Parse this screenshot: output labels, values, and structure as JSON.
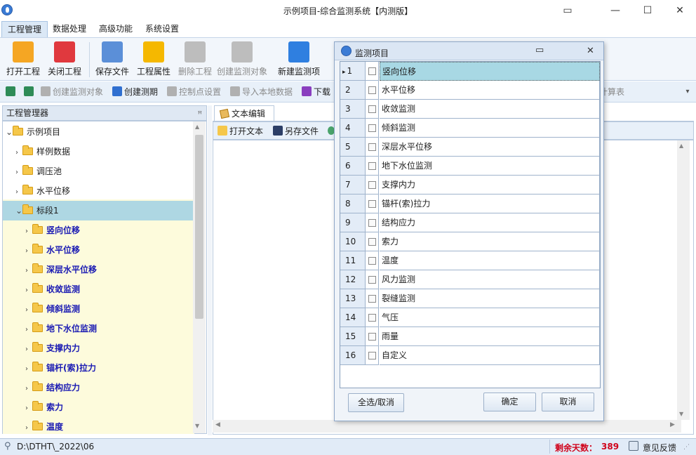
{
  "window": {
    "title": "示例项目-综合监测系统【内测版】",
    "controls": [
      "▭",
      "—",
      "☐",
      "✕"
    ]
  },
  "menu": [
    "工程管理",
    "数据处理",
    "高级功能",
    "系统设置"
  ],
  "ribbon": [
    {
      "label": "打开工程",
      "icon": "open-folder-icon",
      "color": "#f5a623",
      "disabled": false
    },
    {
      "label": "关闭工程",
      "icon": "close-x-icon",
      "color": "#e0393e",
      "disabled": false
    },
    {
      "label": "保存文件",
      "icon": "save-disk-icon",
      "color": "#5b8fd8",
      "disabled": false
    },
    {
      "label": "工程属性",
      "icon": "properties-icon",
      "color": "#f5b800",
      "disabled": false
    },
    {
      "label": "删除工程",
      "icon": "delete-icon",
      "color": "#bdbdbd",
      "disabled": true
    },
    {
      "label": "创建监测对象",
      "icon": "create-object-icon",
      "color": "#bdbdbd",
      "disabled": true
    },
    {
      "label": "新建监测项",
      "icon": "new-item-icon",
      "color": "#2f7fe0",
      "disabled": false
    }
  ],
  "toolbar2": [
    {
      "label": "",
      "icon": "expand-icon",
      "color": "#2e8b57",
      "disabled": false
    },
    {
      "label": "",
      "icon": "tools-icon",
      "color": "#2e8b57",
      "disabled": false
    },
    {
      "label": "创建监测对象",
      "icon": "create-object-icon",
      "color": "#b0b0b0",
      "disabled": true
    },
    {
      "label": "创建测期",
      "icon": "period-icon",
      "color": "#2f6fd0",
      "disabled": false
    },
    {
      "label": "控制点设置",
      "icon": "control-point-icon",
      "color": "#b0b0b0",
      "disabled": true
    },
    {
      "label": "导入本地数据",
      "icon": "import-icon",
      "color": "#b0b0b0",
      "disabled": true
    },
    {
      "label": "下载",
      "icon": "download-icon",
      "color": "#8a3fbf",
      "disabled": false
    }
  ],
  "toolbar2_right_fragment": "计算表",
  "left_panel": {
    "title": "工程管理器",
    "pin": "ꟸ",
    "tree": [
      {
        "label": "示例项目",
        "level": 0,
        "expanded": true,
        "style": "normal"
      },
      {
        "label": "样例数据",
        "level": 1,
        "expanded": false,
        "style": "normal"
      },
      {
        "label": "调压池",
        "level": 1,
        "expanded": false,
        "style": "normal"
      },
      {
        "label": "水平位移",
        "level": 1,
        "expanded": false,
        "style": "normal"
      },
      {
        "label": "标段1",
        "level": 1,
        "expanded": true,
        "style": "selected"
      },
      {
        "label": "竖向位移",
        "level": 2,
        "expanded": false,
        "style": "blue"
      },
      {
        "label": "水平位移",
        "level": 2,
        "expanded": false,
        "style": "blue"
      },
      {
        "label": "深层水平位移",
        "level": 2,
        "expanded": false,
        "style": "blue"
      },
      {
        "label": "收敛监测",
        "level": 2,
        "expanded": false,
        "style": "blue"
      },
      {
        "label": "倾斜监测",
        "level": 2,
        "expanded": false,
        "style": "blue"
      },
      {
        "label": "地下水位监测",
        "level": 2,
        "expanded": false,
        "style": "blue"
      },
      {
        "label": "支撑内力",
        "level": 2,
        "expanded": false,
        "style": "blue"
      },
      {
        "label": "锚杆(索)拉力",
        "level": 2,
        "expanded": false,
        "style": "blue"
      },
      {
        "label": "结构应力",
        "level": 2,
        "expanded": false,
        "style": "blue"
      },
      {
        "label": "索力",
        "level": 2,
        "expanded": false,
        "style": "blue"
      },
      {
        "label": "温度",
        "level": 2,
        "expanded": false,
        "style": "blue"
      }
    ]
  },
  "editor": {
    "tab": "文本编辑",
    "open_text": "打开文本",
    "save_as": "另存文件"
  },
  "dialog": {
    "title": "监测项目",
    "rows": [
      {
        "no": "1",
        "name": "竖向位移",
        "checked": false,
        "selected": true
      },
      {
        "no": "2",
        "name": "水平位移",
        "checked": false,
        "selected": false
      },
      {
        "no": "3",
        "name": "收敛监测",
        "checked": false,
        "selected": false
      },
      {
        "no": "4",
        "name": "倾斜监测",
        "checked": false,
        "selected": false
      },
      {
        "no": "5",
        "name": "深层水平位移",
        "checked": false,
        "selected": false
      },
      {
        "no": "6",
        "name": "地下水位监测",
        "checked": false,
        "selected": false
      },
      {
        "no": "7",
        "name": "支撑内力",
        "checked": false,
        "selected": false
      },
      {
        "no": "8",
        "name": "锚杆(索)拉力",
        "checked": false,
        "selected": false
      },
      {
        "no": "9",
        "name": "结构应力",
        "checked": false,
        "selected": false
      },
      {
        "no": "10",
        "name": "索力",
        "checked": false,
        "selected": false
      },
      {
        "no": "11",
        "name": "温度",
        "checked": false,
        "selected": false
      },
      {
        "no": "12",
        "name": "风力监测",
        "checked": false,
        "selected": false
      },
      {
        "no": "13",
        "name": "裂缝监测",
        "checked": false,
        "selected": false
      },
      {
        "no": "14",
        "name": "气压",
        "checked": false,
        "selected": false
      },
      {
        "no": "15",
        "name": "雨量",
        "checked": false,
        "selected": false
      },
      {
        "no": "16",
        "name": "自定义",
        "checked": false,
        "selected": false
      }
    ],
    "select_all": "全选/取消",
    "ok": "确定",
    "cancel": "取消"
  },
  "status": {
    "path": "D:\\DTHT\\_2022\\06",
    "days_label": "剩余天数：",
    "days": "389",
    "feedback": "意见反馈",
    "days_color": "#d0021b"
  }
}
